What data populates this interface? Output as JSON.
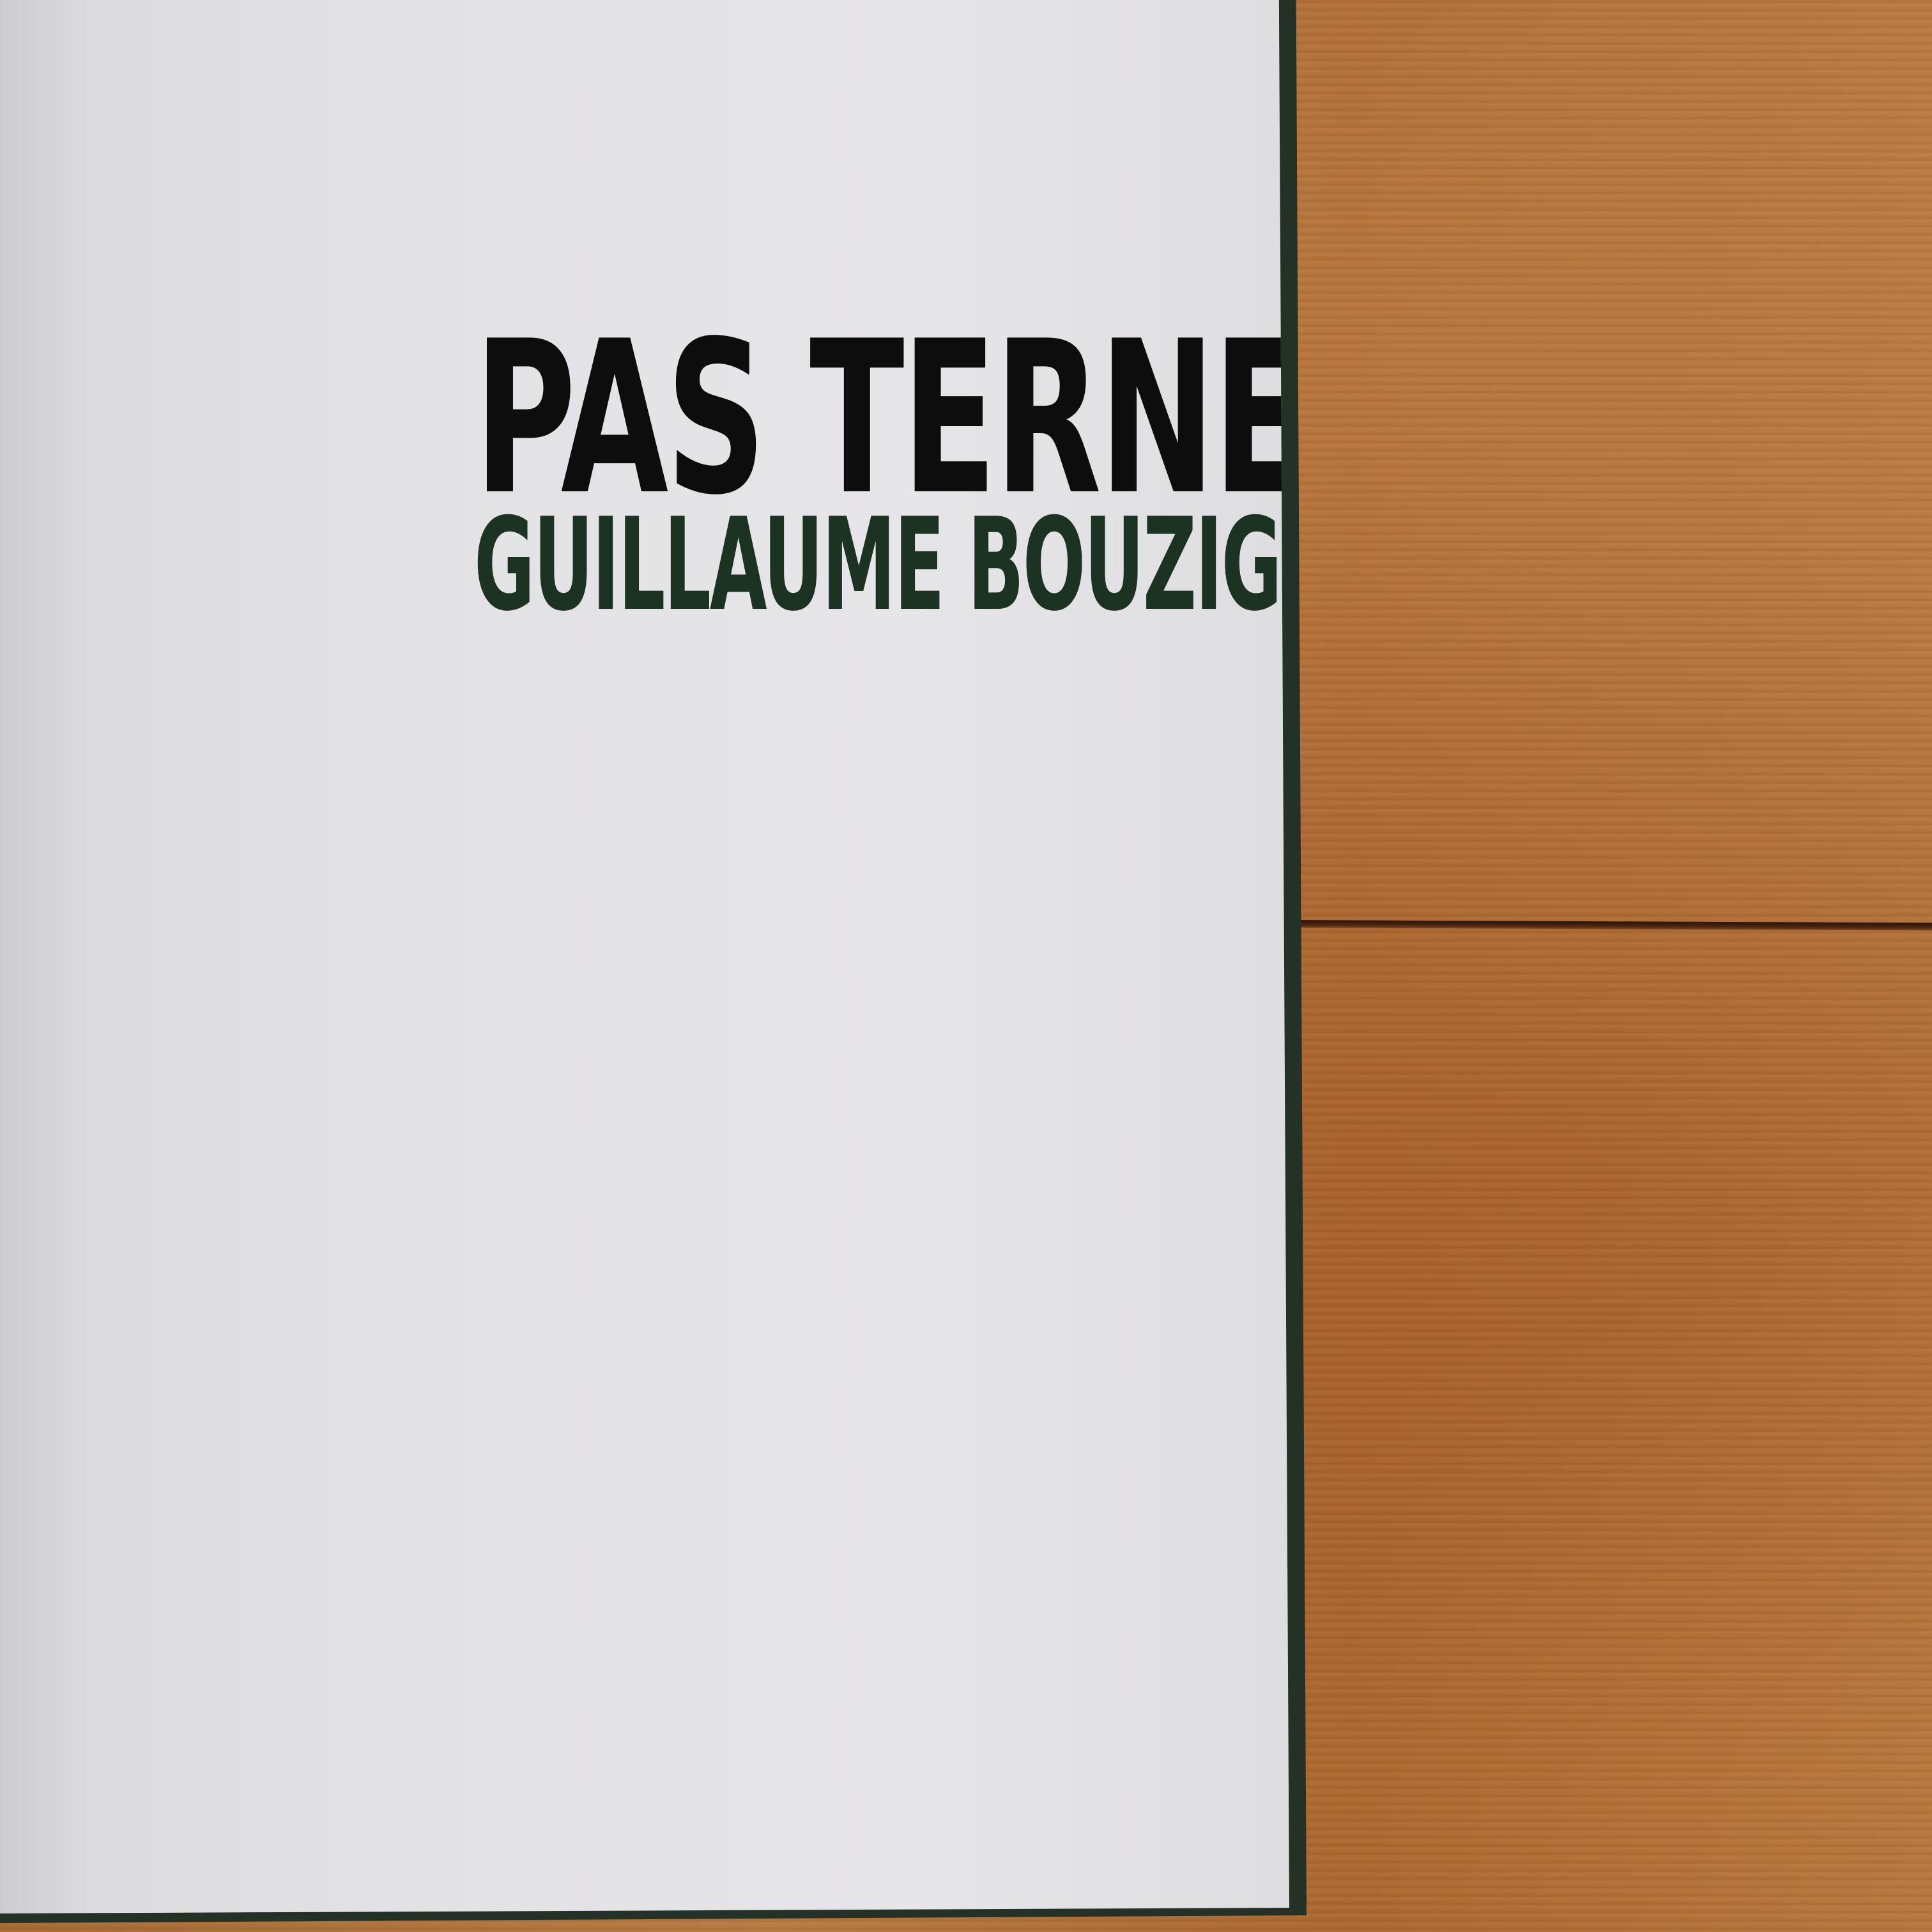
{
  "book": {
    "title": "PAS TERNE",
    "author": "GUILLAUME BOUZIGE"
  },
  "colors": {
    "title_text": "#0d0d0d",
    "author_text": "#1c3324",
    "cover": "#243127",
    "paper": "#e3e2e5",
    "wood": "#a8672f"
  }
}
